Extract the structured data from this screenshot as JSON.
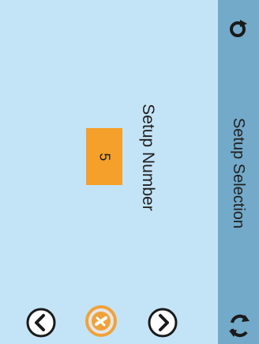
{
  "header": {
    "title": "Setup Selection",
    "left_icon": "reset-icon",
    "right_icon": "sync-icon"
  },
  "setup": {
    "label": "Setup Number",
    "value": "5"
  },
  "controls": {
    "prev_icon": "chevron-left-icon",
    "confirm_icon": "confirm-icon",
    "next_icon": "chevron-right-icon"
  },
  "colors": {
    "background": "#c3e4f7",
    "title_bar": "#73a9c9",
    "value_box": "#f5a02a",
    "confirm": "#f0a23a"
  }
}
